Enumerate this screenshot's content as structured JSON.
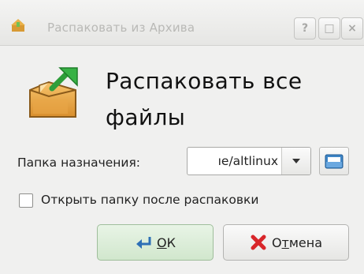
{
  "window": {
    "title": "Распаковать из Архива",
    "help_glyph": "?",
    "maximize_glyph": "□",
    "close_glyph": "×"
  },
  "heading": "Распаковать все файлы",
  "destination": {
    "label": "Папка назначения:",
    "value": "ıe/altlinux"
  },
  "open_after": {
    "label": "Открыть папку после распаковки",
    "checked": false
  },
  "buttons": {
    "ok_mnemonic": "О",
    "ok_rest": "К",
    "cancel_first": "О",
    "cancel_mnemonic": "т",
    "cancel_rest": "мена"
  },
  "icons": {
    "title": "archive-titlebar-icon",
    "main": "extract-archive-icon",
    "browse": "folder-browse-icon",
    "ok": "ok-arrow-icon",
    "cancel": "cancel-x-icon"
  }
}
